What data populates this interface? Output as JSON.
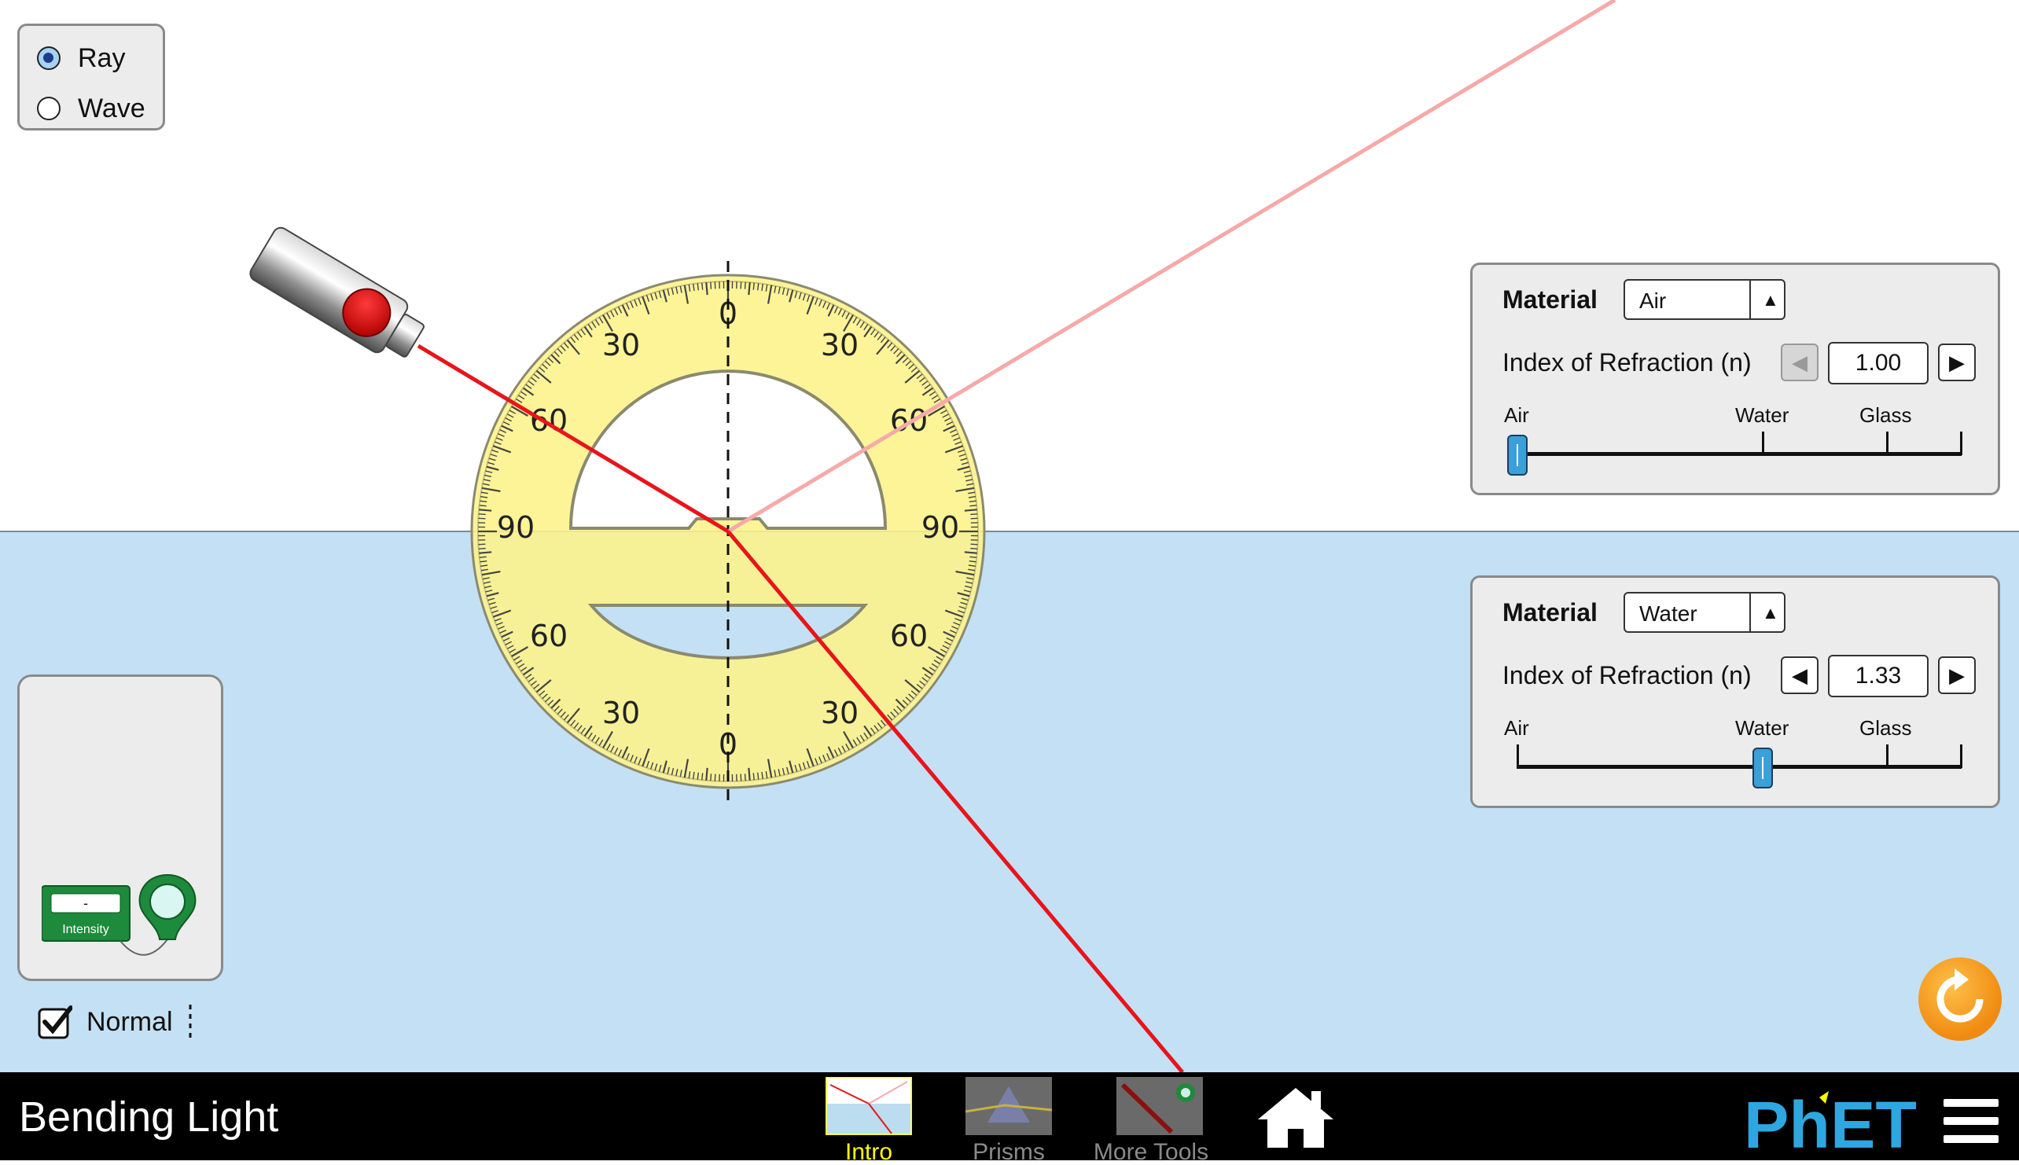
{
  "app": {
    "title": "Bending Light"
  },
  "mode": {
    "options": [
      {
        "label": "Ray",
        "selected": true
      },
      {
        "label": "Wave",
        "selected": false
      }
    ]
  },
  "top_material": {
    "material_label": "Material",
    "material_value": "Air",
    "ior_label": "Index of Refraction (n)",
    "ior_value": "1.00",
    "slider_labels": {
      "air": "Air",
      "water": "Water",
      "glass": "Glass"
    },
    "slider_level": 0
  },
  "bottom_material": {
    "material_label": "Material",
    "material_value": "Water",
    "ior_label": "Index of Refraction (n)",
    "ior_value": "1.33",
    "slider_labels": {
      "air": "Air",
      "water": "Water",
      "glass": "Glass"
    },
    "slider_level": 0.55
  },
  "protractor": {
    "labels": {
      "top_0": "0",
      "left_30_top": "30",
      "right_30_top": "30",
      "left_60_top": "60",
      "right_60_top": "60",
      "left_90": "90",
      "right_90": "90",
      "left_60_bottom": "60",
      "right_60_bottom": "60",
      "left_30_bottom": "30",
      "right_30_bottom": "30",
      "bottom_0": "0"
    }
  },
  "toolbox": {
    "intensity_label": "Intensity",
    "intensity_reading": "-"
  },
  "normal": {
    "label": "Normal",
    "checked": true
  },
  "nav": {
    "tabs": [
      {
        "label": "Intro",
        "selected": true
      },
      {
        "label": "Prisms",
        "selected": false
      },
      {
        "label": "More Tools",
        "selected": false
      }
    ],
    "logo_text": "PhET"
  },
  "colors": {
    "laser": "#e8141b",
    "reflected": "#f7a9a9",
    "water": "#c4e0f4",
    "protractor": "#fdf38a",
    "selected_tab": "#ffff00"
  }
}
